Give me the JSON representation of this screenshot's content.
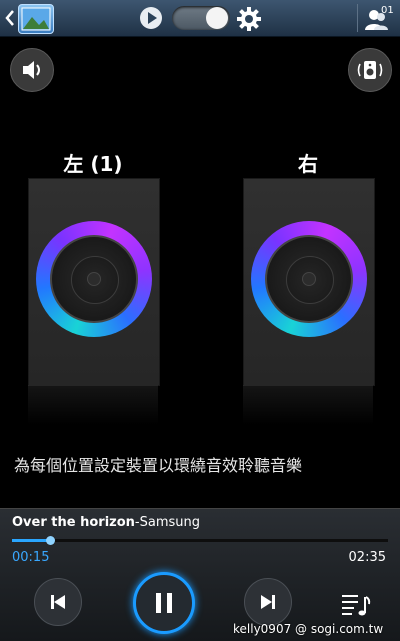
{
  "topbar": {
    "icons": [
      "back-icon",
      "gallery-icon",
      "play-icon",
      "toggle",
      "gear-icon",
      "group-play-user-icon"
    ],
    "user_count": "01"
  },
  "controls": {
    "left_icon": "volume-icon",
    "right_icon": "speaker-icon"
  },
  "speakers": {
    "left_label": "左 (1)",
    "right_label": "右"
  },
  "hint": "為每個位置設定裝置以環繞音效聆聽音樂",
  "player": {
    "song_title": "Over the horizon",
    "song_artist": "-Samsung",
    "time_current": "00:15",
    "time_total": "02:35",
    "progress": 0.1,
    "icons": [
      "previous-icon",
      "pause-icon",
      "next-icon",
      "playlist-icon"
    ]
  },
  "watermark": "kelly0907  @ sogi.com.tw",
  "colors": {
    "accent": "#1a9bff",
    "topbar": "#2b4259"
  }
}
